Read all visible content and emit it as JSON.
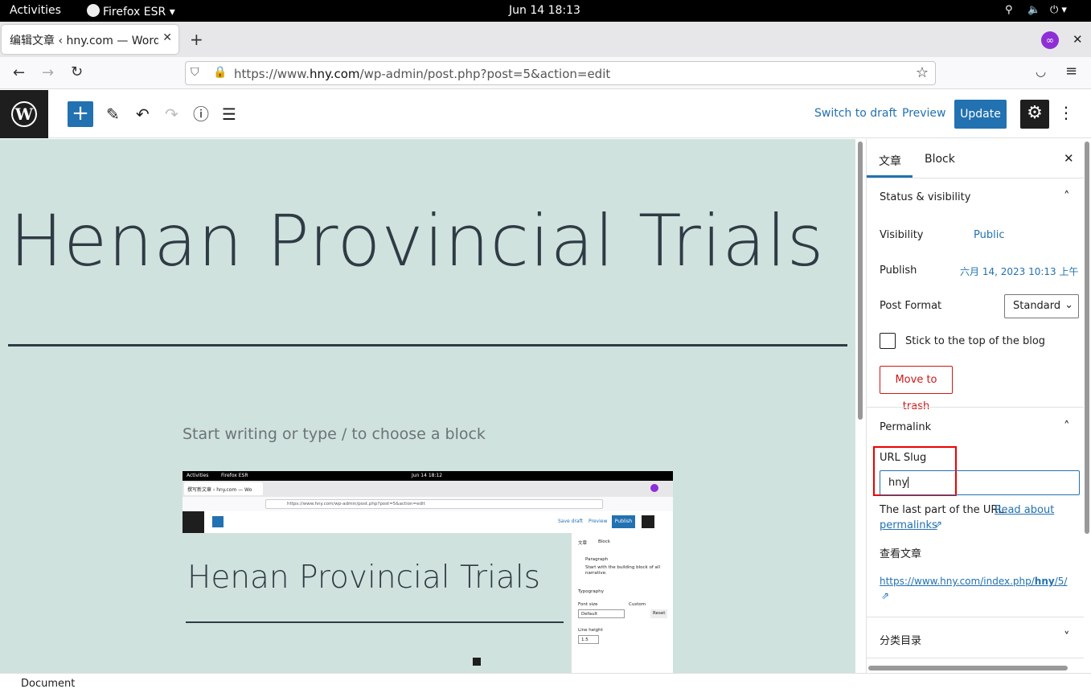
{
  "os": {
    "activities": "Activities",
    "app": "Firefox ESR",
    "datetime": "Jun 14  18:13"
  },
  "browser": {
    "tab_title": "编辑文章 ‹ hny.com — WordPress",
    "url_prefix": "https://www.",
    "url_domain": "hny.com",
    "url_path": "/wp-admin/post.php?post=5&action=edit"
  },
  "wp_toolbar": {
    "switch_to_draft": "Switch to draft",
    "preview": "Preview",
    "update": "Update"
  },
  "editor": {
    "post_title": "Henan Provincial Trials",
    "placeholder": "Start writing or type / to choose a block"
  },
  "sidebar": {
    "tab_post": "文章",
    "tab_block": "Block",
    "status_visibility": "Status & visibility",
    "visibility_label": "Visibility",
    "visibility_value": "Public",
    "publish_label": "Publish",
    "publish_value": "六月 14, 2023 10:13 上午",
    "post_format_label": "Post Format",
    "post_format_value": "Standard",
    "sticky_label": "Stick to the top of the blog",
    "trash_label": "Move to trash",
    "permalink_title": "Permalink",
    "url_slug_label": "URL Slug",
    "url_slug_value": "hny",
    "url_help_text": "The last part of the URL.",
    "read_about": "Read about",
    "permalinks": "permalinks",
    "view_post_label": "查看文章",
    "view_post_url_prefix": "https://www.hny.com/index.php/",
    "view_post_url_slug": "hny",
    "view_post_url_suffix": "/5/",
    "categories_title": "分类目录"
  },
  "thumbnail": {
    "activities": "Activities",
    "app": "Firefox ESR",
    "datetime": "Jun 14  18:12",
    "tab_title": "撰写新文章 ‹ hny.com — Wo",
    "url": "https://www.hny.com/wp-admin/post.php?post=5&action=edit",
    "save_draft": "Save draft",
    "preview": "Preview",
    "publish": "Publish",
    "post_title": "Henan Provincial Trials",
    "tab_post": "文章",
    "tab_block": "Block",
    "paragraph": "Paragraph",
    "paragraph_desc": "Start with the building block of all narrative.",
    "typography": "Typography",
    "font_size": "Font size",
    "custom": "Custom",
    "default": "Default",
    "reset": "Reset",
    "line_height": "Line height",
    "line_height_value": "1.5"
  },
  "statusbar": {
    "breadcrumb": "Document"
  },
  "colors": {
    "wp_blue": "#2271b1",
    "canvas_bg": "#d0e2dd",
    "trash_red": "#cc1818"
  }
}
